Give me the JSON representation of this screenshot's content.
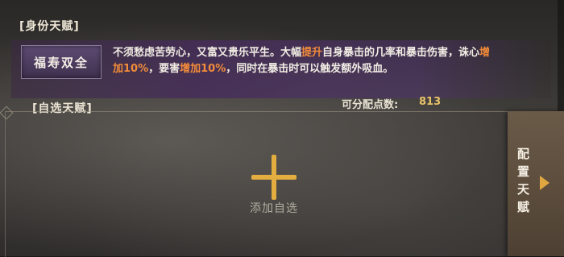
{
  "identity_section": {
    "label": "[身份天赋]",
    "talent_name": "福寿双全",
    "description": {
      "part1": "不须愁虑苦劳心，又富又贵乐平生。大幅",
      "highlight1": "提升",
      "part2": "自身暴击的几率和暴击伤害，诛心",
      "highlight2": "增加10%",
      "part3": "，要害",
      "highlight3": "增加10%",
      "part4": "，同时在暴击时可以触发额外吸血。"
    }
  },
  "custom_section": {
    "label": "[自选天赋]",
    "points_label": "可分配点数:",
    "points_value": "813",
    "add_label": "添加自选"
  },
  "config_button": {
    "label": "配置天赋"
  },
  "colors": {
    "accent_gold": "#e4ad3f",
    "highlight_orange": "#f28b3a",
    "talent_purple": "#5e4b73"
  },
  "icons": {
    "add": "plus-icon",
    "config_arrow": "arrow-right-icon"
  }
}
